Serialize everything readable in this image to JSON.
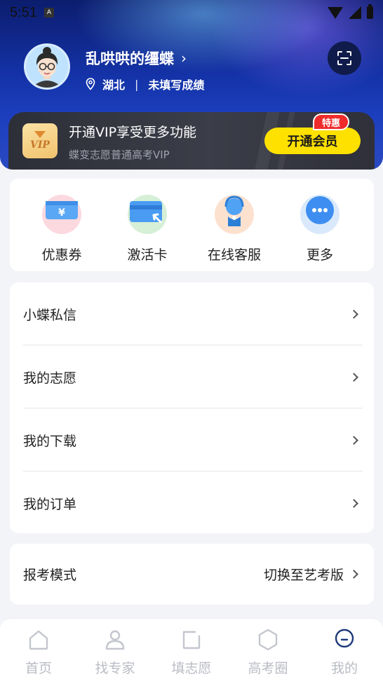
{
  "status_bar": {
    "time": "5:51"
  },
  "profile": {
    "username": "乱哄哄的缰蝶",
    "location": "湖北",
    "score_status": "未填写成绩"
  },
  "vip": {
    "title": "开通VIP享受更多功能",
    "subtitle": "蝶变志愿普通高考VIP",
    "badge_text": "VIP",
    "button": "开通会员",
    "tag": "特惠"
  },
  "quick_actions": [
    {
      "label": "优惠券",
      "icon": "coupon-icon"
    },
    {
      "label": "激活卡",
      "icon": "card-icon"
    },
    {
      "label": "在线客服",
      "icon": "service-icon"
    },
    {
      "label": "更多",
      "icon": "more-icon"
    }
  ],
  "menu": [
    {
      "label": "小蝶私信"
    },
    {
      "label": "我的志愿"
    },
    {
      "label": "我的下载"
    },
    {
      "label": "我的订单"
    }
  ],
  "mode": {
    "label": "报考模式",
    "value": "切换至艺考版"
  },
  "tabs": [
    {
      "label": "首页",
      "icon": "home-icon"
    },
    {
      "label": "找专家",
      "icon": "person-icon"
    },
    {
      "label": "填志愿",
      "icon": "form-icon"
    },
    {
      "label": "高考圈",
      "icon": "hexagon-icon"
    },
    {
      "label": "我的",
      "icon": "profile-icon",
      "active": true
    }
  ],
  "colors": {
    "accent_yellow": "#ffe100",
    "brand_blue": "#1433a8",
    "tag_red": "#ef2b2b",
    "active_tab": "#1e3a7a"
  }
}
